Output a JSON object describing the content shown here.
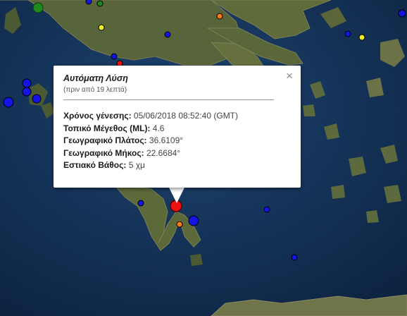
{
  "popup": {
    "title": "Αυτόματη Λύση",
    "subtitle": "(πριν από 19 λεπτά)",
    "close_symbol": "×",
    "rows": [
      {
        "label": "Χρόνος γένεσης:",
        "value": "05/06/2018  08:52:40 (GMT)"
      },
      {
        "label": "Τοπικό Μέγεθος (ML):",
        "value": "4.6"
      },
      {
        "label": "Γεωγραφικό Πλάτος:",
        "value": "36.6109°"
      },
      {
        "label": "Γεωγραφικό Μήκος:",
        "value": "22.6684°"
      },
      {
        "label": "Εστιακό Βάθος:",
        "value": "5 χμ"
      }
    ]
  },
  "legend_colors": {
    "sea": "#1a3b62",
    "land": "#5d6a3a",
    "marker_blue": "#1414e6",
    "marker_green": "#1e8a1e",
    "marker_yellow": "#f0f020",
    "marker_orange": "#ff7a1a",
    "marker_red": "#ee1111"
  }
}
